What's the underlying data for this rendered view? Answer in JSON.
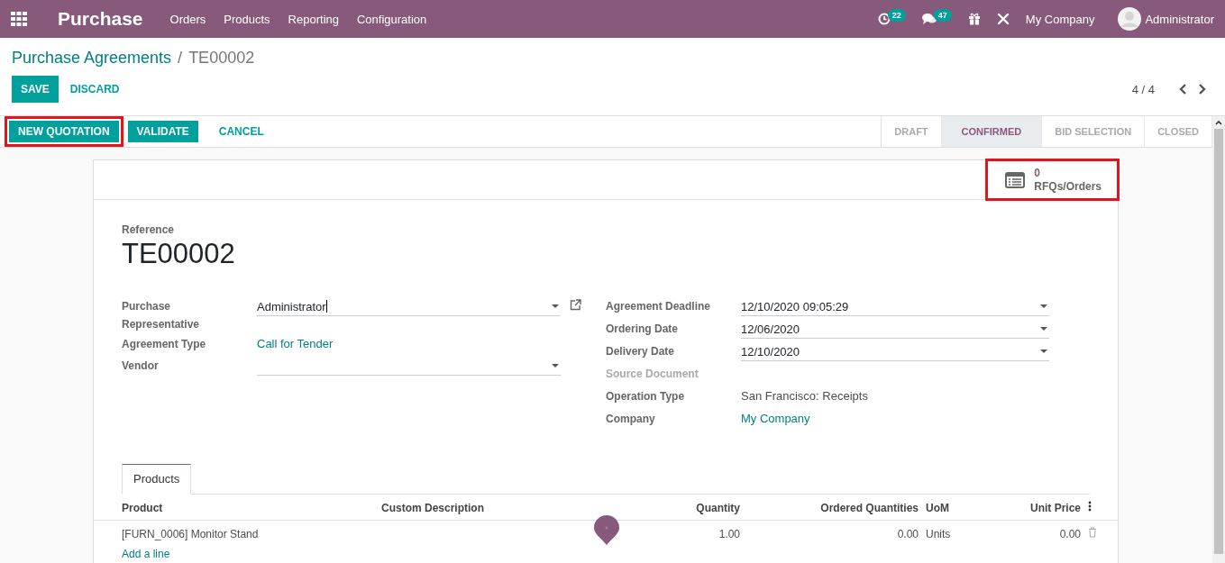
{
  "navbar": {
    "app_name": "Purchase",
    "menu": [
      "Orders",
      "Products",
      "Reporting",
      "Configuration"
    ],
    "activity_count": "22",
    "message_count": "47",
    "company": "My Company",
    "user": "Administrator"
  },
  "breadcrumb": {
    "parent": "Purchase Agreements",
    "separator": "/",
    "current": "TE00002"
  },
  "actions": {
    "save": "SAVE",
    "discard": "DISCARD",
    "pager": "4 / 4"
  },
  "header_buttons": [
    {
      "label": "NEW QUOTATION",
      "kind": "primary",
      "highlighted": true
    },
    {
      "label": "VALIDATE",
      "kind": "primary",
      "highlighted": false
    },
    {
      "label": "CANCEL",
      "kind": "link",
      "highlighted": false
    }
  ],
  "stages": [
    {
      "label": "DRAFT",
      "selected": false
    },
    {
      "label": "CONFIRMED",
      "selected": true
    },
    {
      "label": "BID SELECTION",
      "selected": false
    },
    {
      "label": "CLOSED",
      "selected": false
    }
  ],
  "smart_button": {
    "count": "0",
    "label": "RFQs/Orders",
    "highlighted": true
  },
  "reference": {
    "label": "Reference",
    "value": "TE00002"
  },
  "left_fields": [
    {
      "label": "Purchase Representative",
      "value": "Administrator",
      "kind": "select",
      "external_link": true
    },
    {
      "label": "Agreement Type",
      "value": "Call for Tender",
      "kind": "link"
    },
    {
      "label": "Vendor",
      "kind": "select",
      "external_link": false
    }
  ],
  "right_fields": [
    {
      "label": "Agreement Deadline",
      "value": "12/10/2020 09:05:29",
      "kind": "select",
      "disabled": false
    },
    {
      "label": "Ordering Date",
      "value": "12/06/2020",
      "kind": "select",
      "disabled": false
    },
    {
      "label": "Delivery Date",
      "value": "12/10/2020",
      "kind": "select",
      "disabled": false
    },
    {
      "label": "Source Document",
      "kind": "text",
      "disabled": true
    },
    {
      "label": "Operation Type",
      "value": "San Francisco: Receipts",
      "kind": "text",
      "disabled": false
    },
    {
      "label": "Company",
      "value": "My Company",
      "kind": "link",
      "disabled": false
    }
  ],
  "tabs": [
    {
      "label": "Products",
      "selected": true
    }
  ],
  "table": {
    "columns": [
      "Product",
      "Custom Description",
      "Quantity",
      "Ordered Quantities",
      "UoM",
      "Unit Price"
    ],
    "rows": [
      [
        "[FURN_0006] Monitor Stand",
        "",
        "1.00",
        "0.00",
        "Units",
        "0.00"
      ]
    ],
    "add_line": "Add a line"
  }
}
